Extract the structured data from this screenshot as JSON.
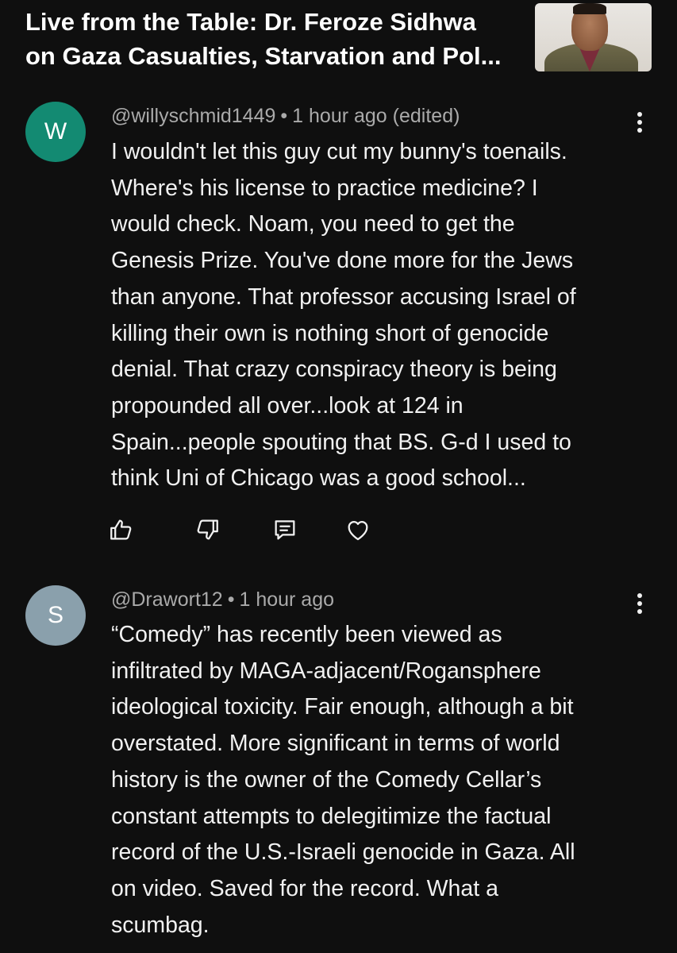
{
  "video": {
    "title": "Live from the Table: Dr. Feroze Sidhwa\non Gaza Casualties, Starvation and Pol..."
  },
  "colors": {
    "background": "#0f0f0f",
    "avatar_w": "#138a72",
    "avatar_s": "#8aa0ac",
    "meta_text": "#aaaaaa"
  },
  "comments": [
    {
      "avatar_letter": "W",
      "author": "@willyschmid1449",
      "separator": "•",
      "time": "1 hour ago (edited)",
      "text": "I wouldn't let this guy cut my bunny's toenails.\nWhere's his license to practice medicine? I\nwould check. Noam, you need to get the\nGenesis Prize. You've done more for the Jews\nthan anyone. That professor accusing Israel of\nkilling their own is nothing short of genocide\ndenial. That crazy conspiracy theory is being\npropounded all over...look at 124 in\nSpain...people spouting that BS. G-d I used to\nthink Uni of Chicago was a good school...",
      "icons": [
        "thumbs-up-icon",
        "thumbs-down-icon",
        "reply-icon",
        "heart-icon",
        "more-vert-icon"
      ]
    },
    {
      "avatar_letter": "S",
      "author": "@Drawort12",
      "separator": "•",
      "time": "1 hour ago",
      "text": "“Comedy” has recently been viewed as\ninfiltrated by MAGA-adjacent/Rogansphere\nideological toxicity. Fair enough, although a bit\noverstated. More significant in terms of world\nhistory is the owner of the Comedy Cellar’s\nconstant attempts to delegitimize the factual\nrecord of the U.S.-Israeli genocide in Gaza. All\non video. Saved for the record. What a\nscumbag.",
      "icons": [
        "more-vert-icon"
      ]
    }
  ]
}
